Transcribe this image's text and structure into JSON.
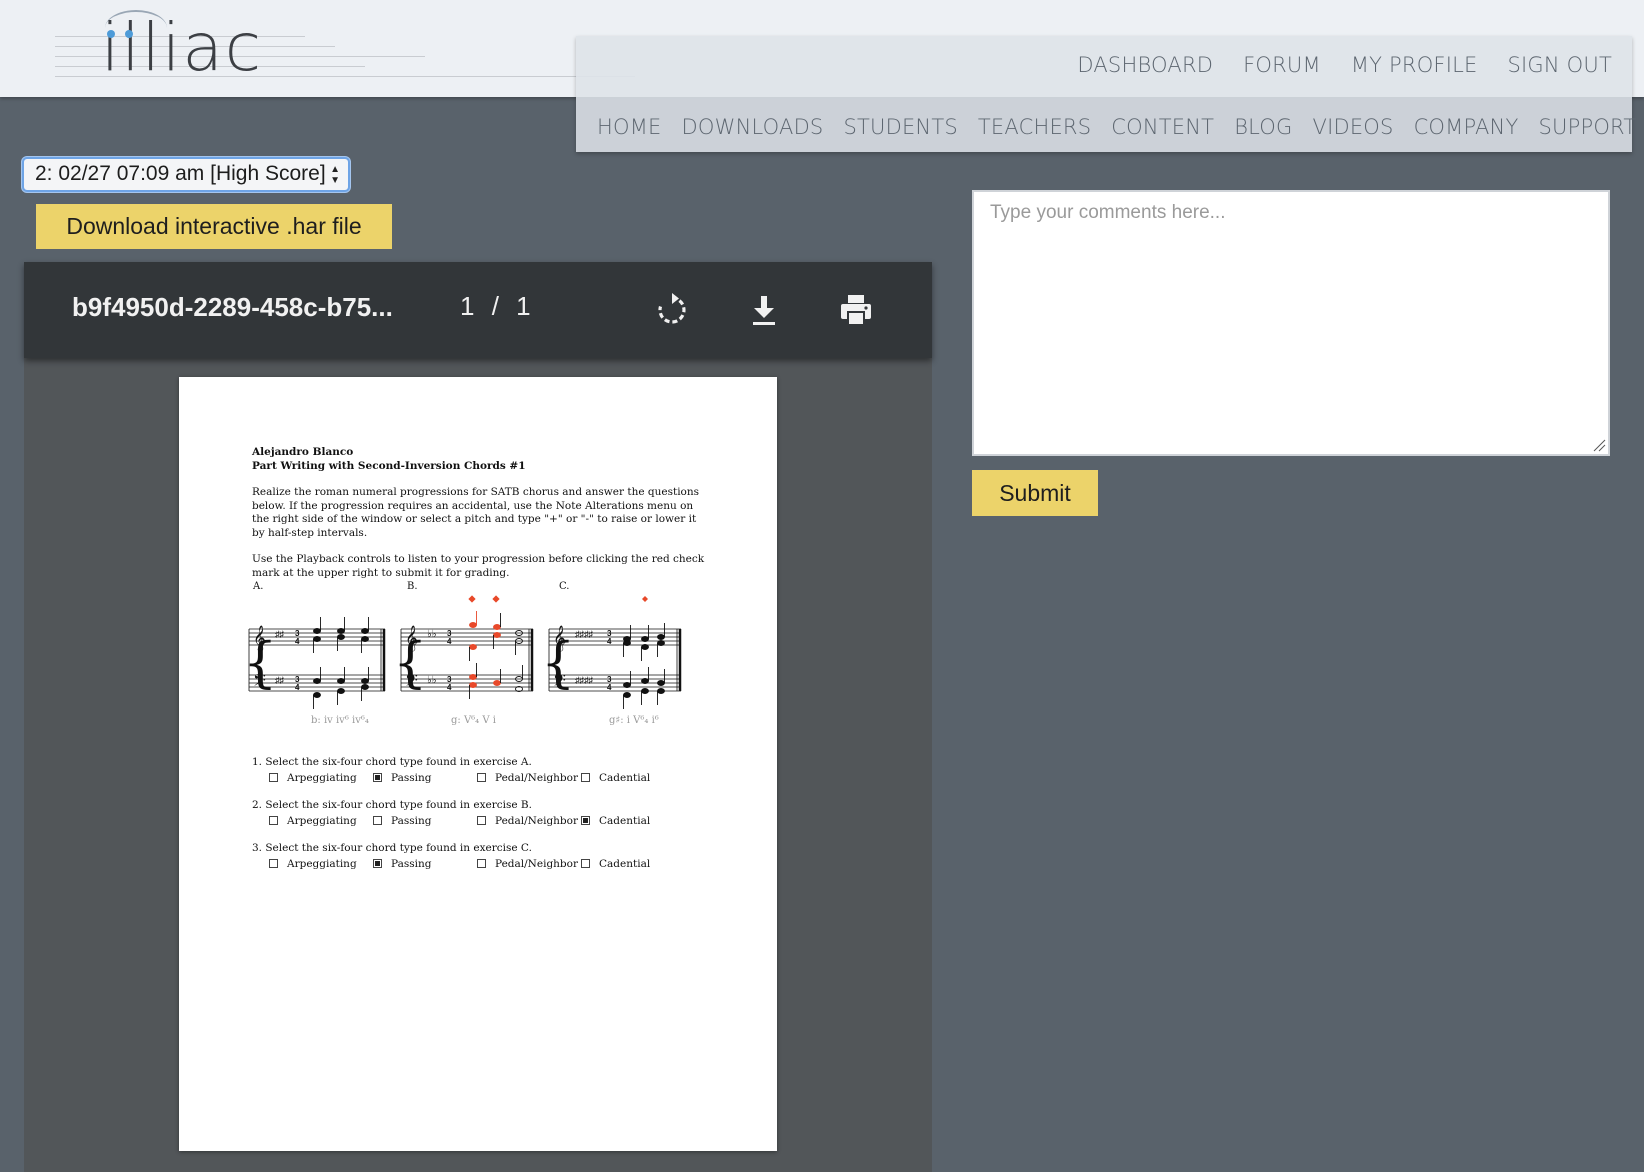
{
  "brand": {
    "logo_text": "illiac"
  },
  "nav": {
    "top": [
      "DASHBOARD",
      "FORUM",
      "MY PROFILE",
      "SIGN OUT"
    ],
    "bottom": [
      "HOME",
      "DOWNLOADS",
      "STUDENTS",
      "TEACHERS",
      "CONTENT",
      "BLOG",
      "VIDEOS",
      "COMPANY",
      "SUPPORT"
    ]
  },
  "attempt_select": {
    "value": "2: 02/27 07:09 am [High Score]"
  },
  "download_har": {
    "label": "Download interactive .har file"
  },
  "viewer": {
    "file_title": "b9f4950d-2289-458c-b75...",
    "page_current": "1",
    "page_separator": "/",
    "page_total": "1",
    "icons": [
      "rotate-icon",
      "download-icon",
      "print-icon"
    ]
  },
  "document": {
    "author": "Alejandro Blanco",
    "title": "Part Writing with Second-Inversion Chords #1",
    "instructions_1": "Realize the roman numeral progressions for SATB chorus and answer the questions below. If the progression requires an accidental, use the Note Alterations menu on the right side of the window or select a pitch and type \"+\" or \"-\" to raise or lower it by half-step intervals.",
    "instructions_2": "Use the Playback controls to listen to your progression before clicking the red check mark at the upper right to submit it for grading.",
    "exercises": [
      {
        "label": "A.",
        "analysis": "b: iv   iv⁶   iv⁶₄"
      },
      {
        "label": "B.",
        "analysis": "g: V⁶₄   V   i"
      },
      {
        "label": "C.",
        "analysis": "g♯: i   V⁶₄   i⁶"
      }
    ],
    "questions": [
      {
        "text": "1. Select the six-four chord type found in exercise A.",
        "selected": "Passing"
      },
      {
        "text": "2. Select the six-four chord type found in exercise B.",
        "selected": "Cadential"
      },
      {
        "text": "3. Select the six-four chord type found in exercise C.",
        "selected": "Passing"
      }
    ],
    "options": [
      "Arpeggiating",
      "Passing",
      "Pedal/Neighbor",
      "Cadential"
    ]
  },
  "comments": {
    "placeholder": "Type your comments here..."
  },
  "submit": {
    "label": "Submit"
  },
  "colors": {
    "background": "#59626b",
    "header": "#edf0f4",
    "button": "#ecd36a",
    "viewer_toolbar": "#323639",
    "viewer_bg": "#525659",
    "note_highlight": "#e8492a",
    "logo_dot": "#4d9bd8"
  }
}
